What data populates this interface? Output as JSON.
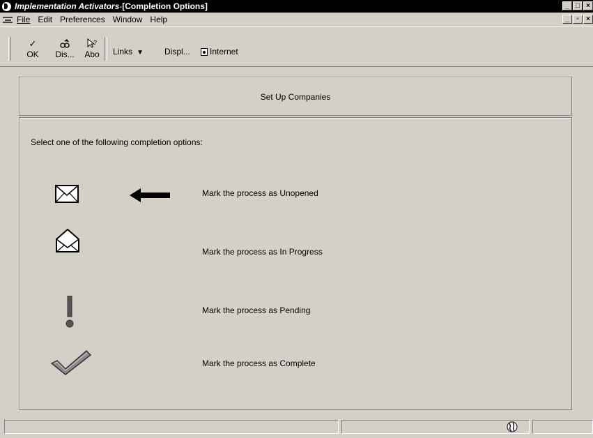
{
  "window": {
    "title_app": "Implementation Activators",
    "title_sep": " - ",
    "title_form": "[Completion Options]",
    "min_glyph": "_",
    "max_glyph": "□",
    "close_glyph": "×",
    "restore_glyph": "▫"
  },
  "menubar": {
    "items": [
      {
        "label": "File",
        "accel": "F"
      },
      {
        "label": "Edit",
        "accel": "E"
      },
      {
        "label": "Preferences",
        "accel": "P"
      },
      {
        "label": "Window",
        "accel": "W"
      },
      {
        "label": "Help",
        "accel": "H"
      }
    ]
  },
  "toolbar": {
    "ok_label": "OK",
    "ok_icon": "checkmark-icon",
    "dis_label": "Dis...",
    "dis_icon": "display-icon",
    "abo_label": "Abo",
    "abo_icon": "help-pointer-icon",
    "links_label": "Links",
    "display_label": "Displ...",
    "internet_label": "Internet"
  },
  "header": {
    "title": "Set Up Companies"
  },
  "main": {
    "instruction": "Select one of the following completion options:",
    "options": [
      {
        "label": "Mark the process as Unopened",
        "icon": "closed-envelope-icon",
        "selected": true
      },
      {
        "label": "Mark the process as In Progress",
        "icon": "open-envelope-icon",
        "selected": false
      },
      {
        "label": "Mark the process as Pending",
        "icon": "exclamation-icon",
        "selected": false
      },
      {
        "label": "Mark the process as Complete",
        "icon": "checkmark-icon",
        "selected": false
      }
    ]
  },
  "colors": {
    "face": "#d4d0c8",
    "titlebar": "#000000"
  }
}
